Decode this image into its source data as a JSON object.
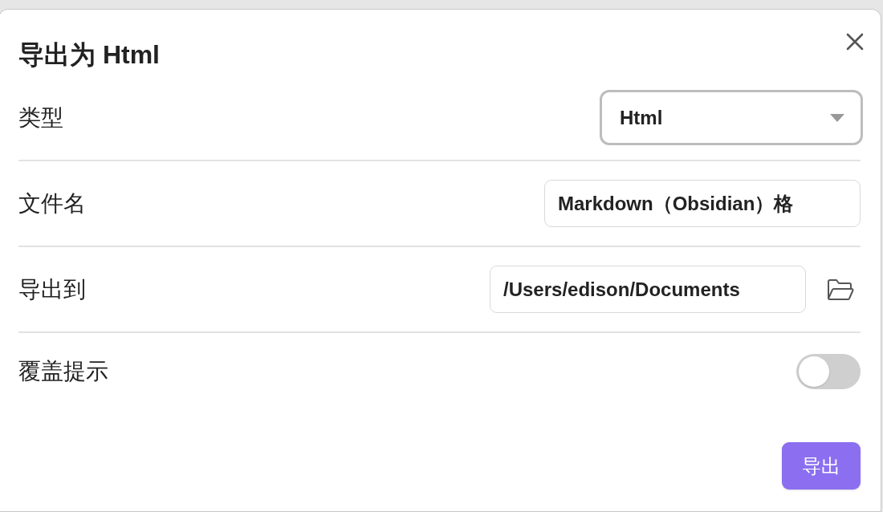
{
  "dialog": {
    "title": "导出为 Html",
    "fields": [
      {
        "kind": "select",
        "label": "类型",
        "value": "Html"
      },
      {
        "kind": "text",
        "label": "文件名",
        "value": "Markdown（Obsidian）格"
      },
      {
        "kind": "path",
        "label": "导出到",
        "value": "/Users/edison/Documents"
      },
      {
        "kind": "toggle",
        "label": "覆盖提示",
        "on": false
      }
    ],
    "buttons": [
      {
        "label": "导出"
      }
    ]
  }
}
